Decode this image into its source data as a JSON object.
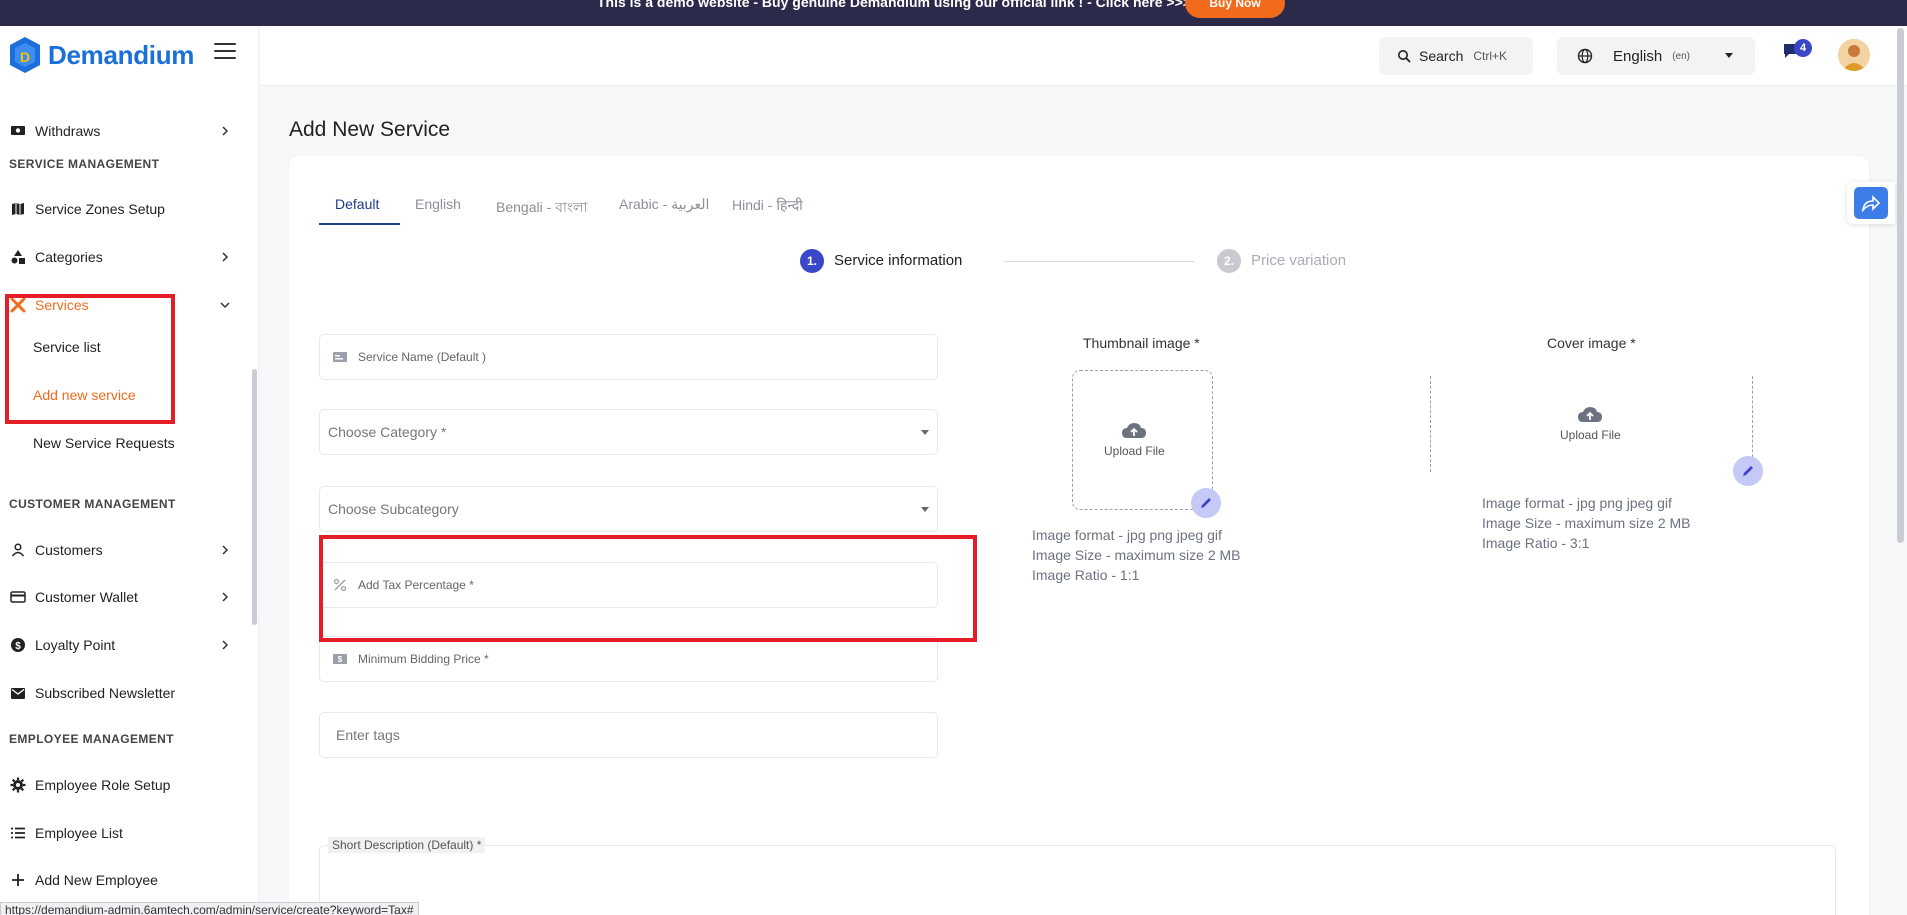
{
  "banner": {
    "text": "This is a demo website - Buy genuine Demandium using our official link ! - Click here >>>",
    "button": "Buy Now"
  },
  "brand": {
    "name": "Demandium"
  },
  "sidebar": {
    "withdraws": "Withdraws",
    "service_management": "SERVICE MANAGEMENT",
    "service_zones": "Service Zones Setup",
    "categories": "Categories",
    "services": "Services",
    "service_list": "Service list",
    "add_new_service": "Add new service",
    "new_service_requests": "New Service Requests",
    "customer_management": "CUSTOMER MANAGEMENT",
    "customers": "Customers",
    "customer_wallet": "Customer Wallet",
    "loyalty_point": "Loyalty Point",
    "subscribed_newsletter": "Subscribed Newsletter",
    "employee_management": "EMPLOYEE MANAGEMENT",
    "employee_role_setup": "Employee Role Setup",
    "employee_list": "Employee List",
    "add_new_employee": "Add New Employee"
  },
  "topbar": {
    "search_label": "Search",
    "search_shortcut": "Ctrl+K",
    "language": "English",
    "language_code": "(en)",
    "message_count": "4"
  },
  "page": {
    "title": "Add New Service",
    "tabs": [
      "Default",
      "English",
      "Bengali - বাংলা",
      "Arabic - العربية",
      "Hindi - हिन्दी"
    ],
    "steps": [
      {
        "num": "1.",
        "label": "Service information"
      },
      {
        "num": "2.",
        "label": "Price variation"
      }
    ],
    "fields": {
      "service_name": "Service Name (Default )",
      "category": "Choose Category *",
      "subcategory": "Choose Subcategory",
      "tax": "Add Tax Percentage *",
      "min_bidding": "Minimum Bidding Price *",
      "tags": "Enter tags"
    },
    "thumbnail": {
      "label": "Thumbnail image *",
      "upload": "Upload File",
      "format": "Image format - jpg png jpeg gif",
      "size": "Image Size - maximum size 2 MB",
      "ratio": "Image Ratio - 1:1"
    },
    "cover": {
      "label": "Cover image *",
      "upload": "Upload File",
      "format": "Image format - jpg png jpeg gif",
      "size": "Image Size - maximum size 2 MB",
      "ratio": "Image Ratio - 3:1"
    },
    "short_description_label": "Short Description (Default) *"
  },
  "status_url": "https://demandium-admin.6amtech.com/admin/service/create?keyword=Tax#",
  "colors": {
    "brand": "#1a6fd8",
    "accent_orange": "#f26b1d",
    "active_step": "#3a47c8",
    "highlight": "#e41e26"
  }
}
